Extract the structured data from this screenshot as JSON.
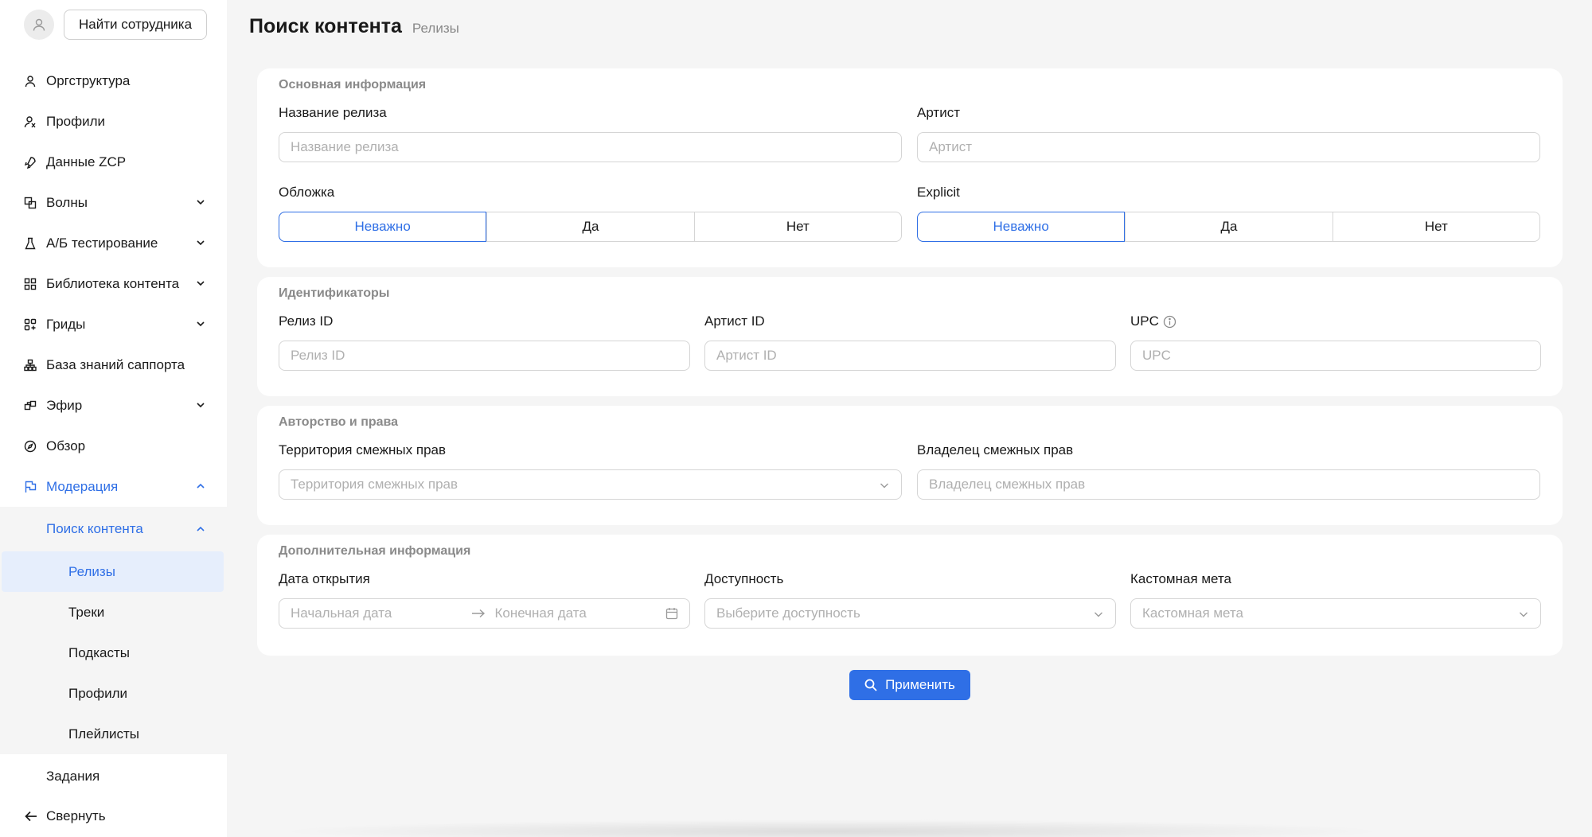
{
  "sidebar": {
    "find_employee": "Найти сотрудника",
    "items": [
      {
        "label": "Оргструктура",
        "icon": "user-icon"
      },
      {
        "label": "Профили",
        "icon": "profiles-icon"
      },
      {
        "label": "Данные ZCP",
        "icon": "rocket-icon"
      },
      {
        "label": "Волны",
        "icon": "layers-icon"
      },
      {
        "label": "А/Б тестирование",
        "icon": "flask-icon"
      },
      {
        "label": "Библиотека контента",
        "icon": "grid-icon"
      },
      {
        "label": "Гриды",
        "icon": "grid-alt-icon"
      },
      {
        "label": "База знаний саппорта",
        "icon": "org-icon"
      },
      {
        "label": "Эфир",
        "icon": "broadcast-icon"
      },
      {
        "label": "Обзор",
        "icon": "compass-icon"
      },
      {
        "label": "Модерация",
        "icon": "flag-icon"
      }
    ],
    "moderation": {
      "search_content": "Поиск контента",
      "children": [
        "Релизы",
        "Треки",
        "Подкасты",
        "Профили",
        "Плейлисты"
      ],
      "tasks": "Задания"
    },
    "collapse": "Свернуть"
  },
  "header": {
    "title": "Поиск контента",
    "crumb": "Релизы"
  },
  "sections": {
    "main_info": {
      "title": "Основная информация",
      "release_name_label": "Название релиза",
      "release_name_placeholder": "Название релиза",
      "artist_label": "Артист",
      "artist_placeholder": "Артист",
      "cover_label": "Обложка",
      "cover_options": [
        "Неважно",
        "Да",
        "Нет"
      ],
      "explicit_label": "Explicit",
      "explicit_options": [
        "Неважно",
        "Да",
        "Нет"
      ]
    },
    "identifiers": {
      "title": "Идентификаторы",
      "release_id_label": "Релиз ID",
      "release_id_placeholder": "Релиз ID",
      "artist_id_label": "Артист ID",
      "artist_id_placeholder": "Артист ID",
      "upc_label": "UPC",
      "upc_placeholder": "UPC"
    },
    "rights": {
      "title": "Авторство и права",
      "territory_label": "Территория смежных прав",
      "territory_placeholder": "Территория смежных прав",
      "owner_label": "Владелец смежных прав",
      "owner_placeholder": "Владелец смежных прав"
    },
    "extra": {
      "title": "Дополнительная информация",
      "open_date_label": "Дата открытия",
      "start_date_placeholder": "Начальная дата",
      "end_date_placeholder": "Конечная дата",
      "availability_label": "Доступность",
      "availability_placeholder": "Выберите доступность",
      "custom_meta_label": "Кастомная мета",
      "custom_meta_placeholder": "Кастомная мета"
    }
  },
  "apply_label": "Применить",
  "colors": {
    "accent": "#2f6fe6",
    "background": "#f5f5f5",
    "card": "#ffffff"
  }
}
